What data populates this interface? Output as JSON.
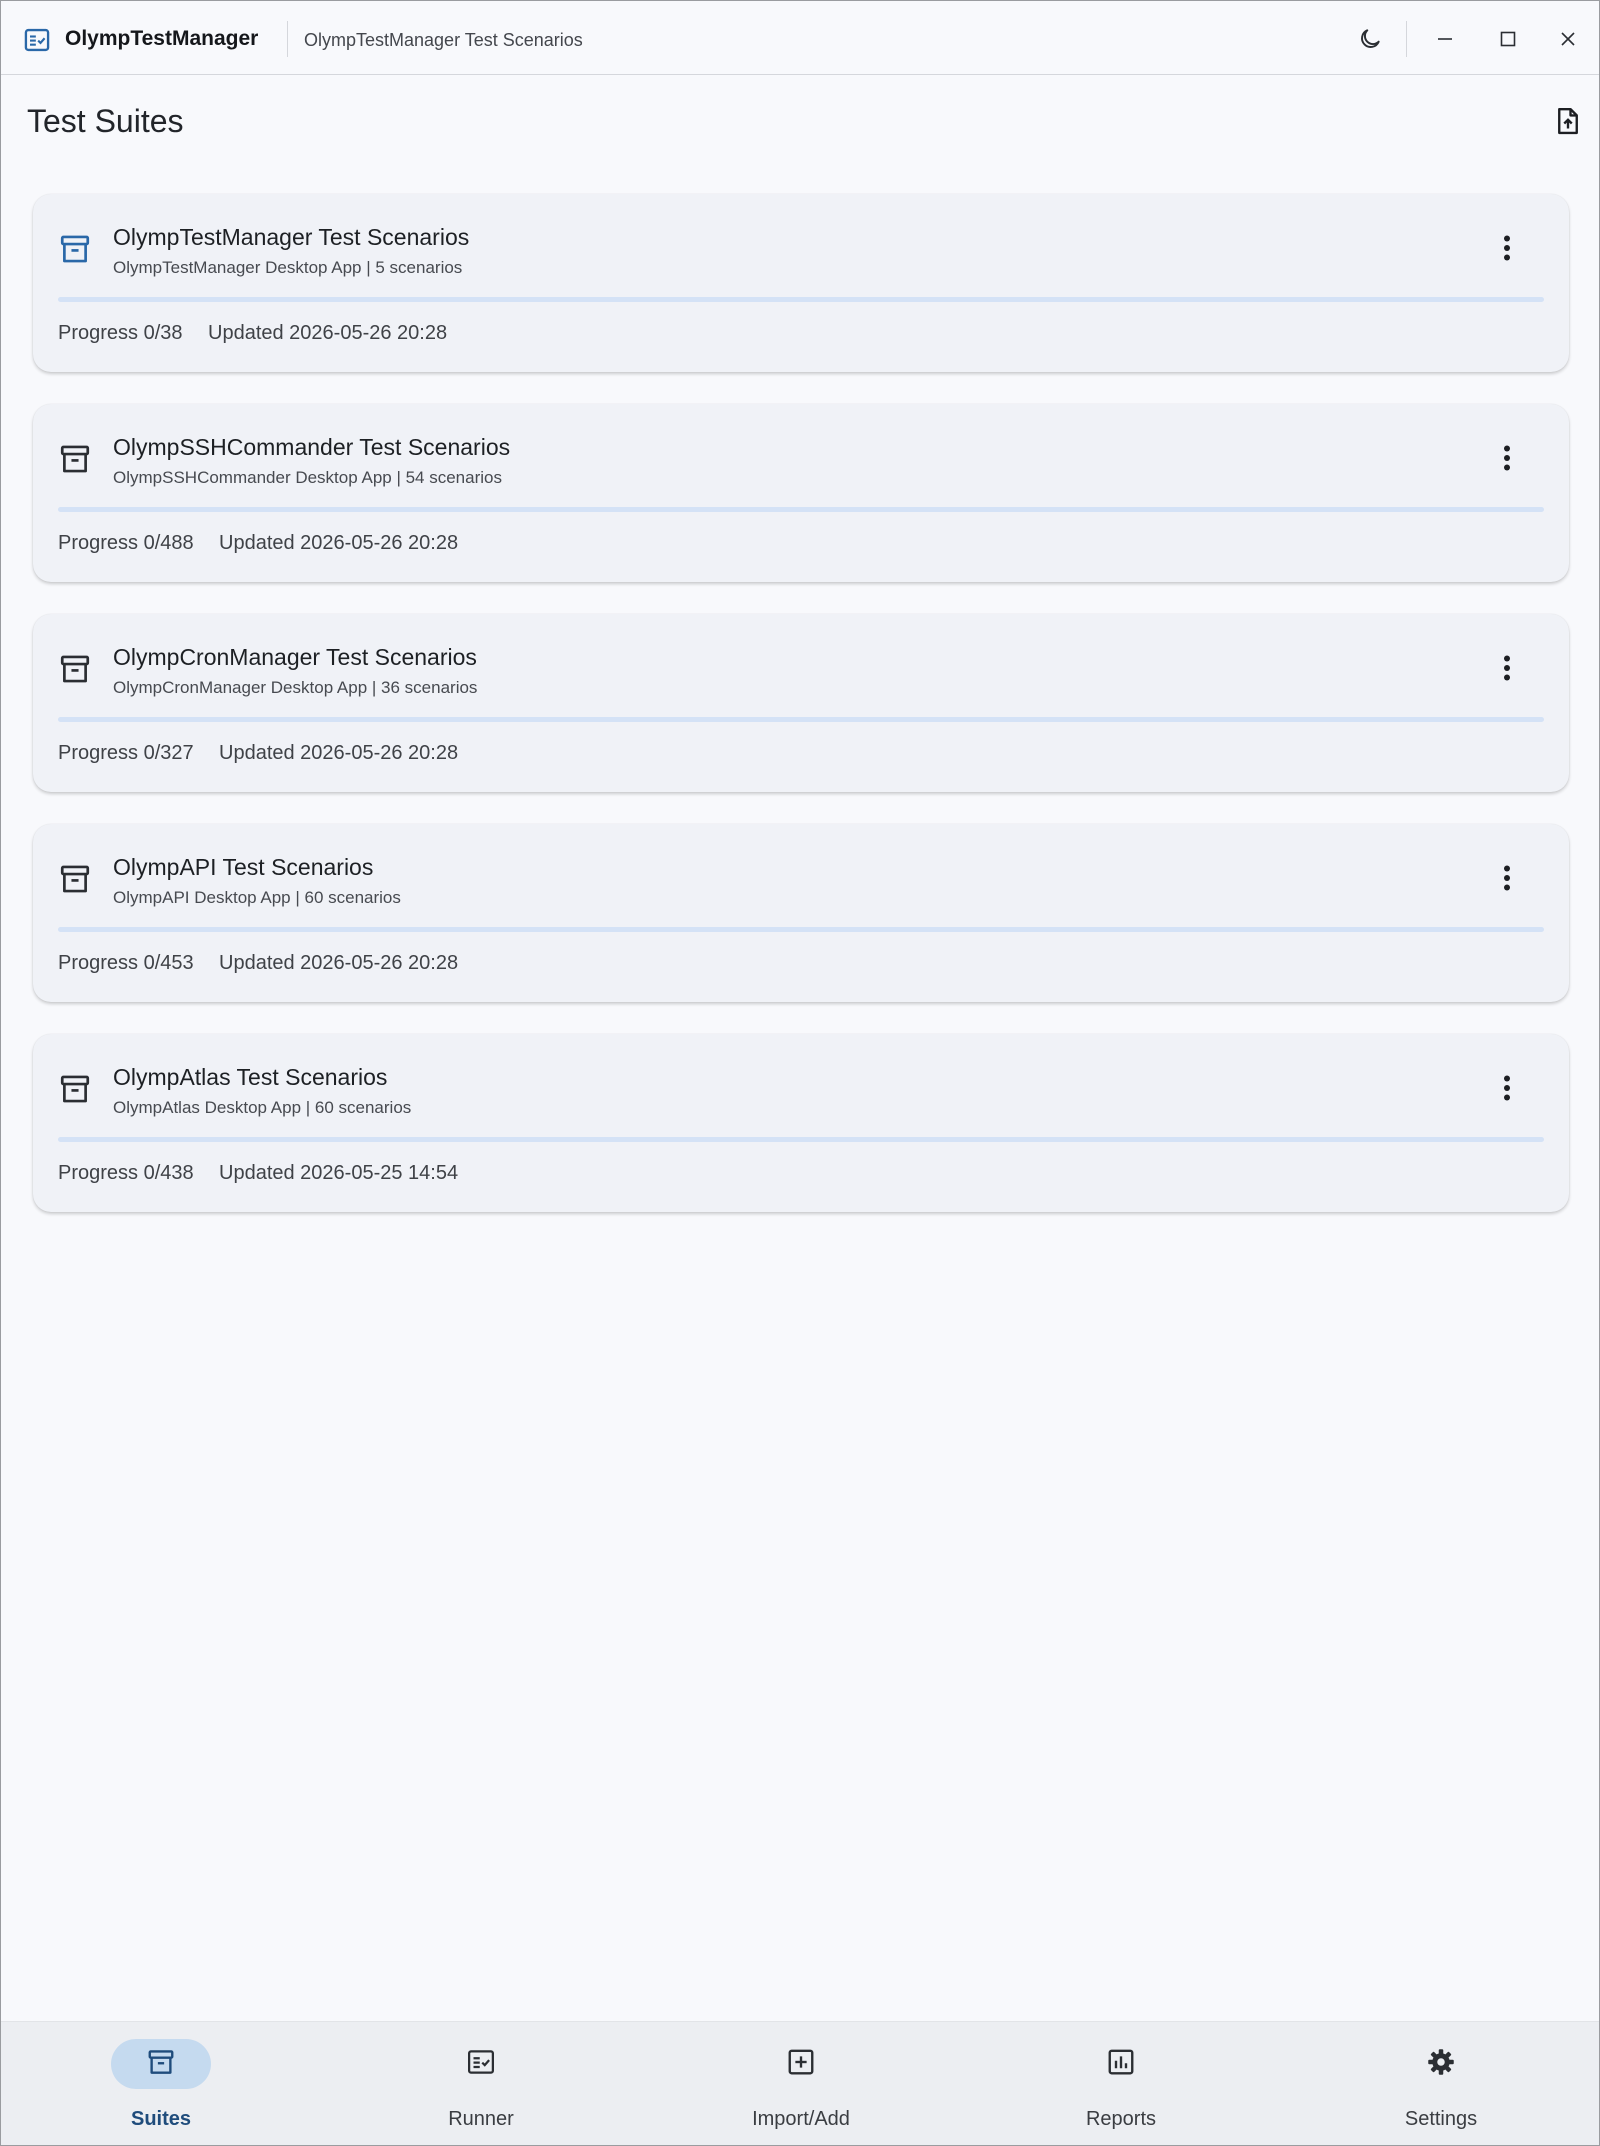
{
  "app": {
    "name": "OlympTestManager",
    "window_title": "OlympTestManager Test Scenarios"
  },
  "page": {
    "title": "Test Suites"
  },
  "suites": [
    {
      "name": "OlympTestManager Test Scenarios",
      "subtitle": "OlympTestManager Desktop App | 5 scenarios",
      "progress": "Progress 0/38",
      "progress_fraction": 0,
      "updated": "Updated 2026-05-26 20:28",
      "selected": true
    },
    {
      "name": "OlympSSHCommander Test Scenarios",
      "subtitle": "OlympSSHCommander Desktop App | 54 scenarios",
      "progress": "Progress 0/488",
      "progress_fraction": 0,
      "updated": "Updated 2026-05-26 20:28",
      "selected": false
    },
    {
      "name": "OlympCronManager Test Scenarios",
      "subtitle": "OlympCronManager Desktop App | 36 scenarios",
      "progress": "Progress 0/327",
      "progress_fraction": 0,
      "updated": "Updated 2026-05-26 20:28",
      "selected": false
    },
    {
      "name": "OlympAPI Test Scenarios",
      "subtitle": "OlympAPI Desktop App | 60 scenarios",
      "progress": "Progress 0/453",
      "progress_fraction": 0,
      "updated": "Updated 2026-05-26 20:28",
      "selected": false
    },
    {
      "name": "OlympAtlas Test Scenarios",
      "subtitle": "OlympAtlas Desktop App | 60 scenarios",
      "progress": "Progress 0/438",
      "progress_fraction": 0,
      "updated": "Updated 2026-05-25 14:54",
      "selected": false
    }
  ],
  "nav": {
    "items": [
      {
        "label": "Suites",
        "icon": "archive-icon",
        "active": true
      },
      {
        "label": "Runner",
        "icon": "checklist-icon",
        "active": false
      },
      {
        "label": "Import/Add",
        "icon": "add-box-icon",
        "active": false
      },
      {
        "label": "Reports",
        "icon": "bar-chart-icon",
        "active": false
      },
      {
        "label": "Settings",
        "icon": "gear-icon",
        "active": false
      }
    ]
  },
  "colors": {
    "accent": "#2a68a8",
    "nav_active_pill": "#c5daef",
    "progress_track": "#d4e2f6",
    "card_background": "#f0f2f7",
    "page_background": "#f8f9fc"
  }
}
